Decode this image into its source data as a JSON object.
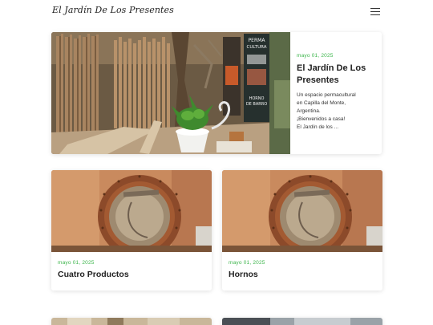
{
  "header": {
    "logo_text": "El Jardín De Los Presentes",
    "menu_icon": "hamburger-menu-icon"
  },
  "posts": {
    "featured": {
      "date": "mayo 01, 2025",
      "title_line1": "El Jardín De Los",
      "title_line2": "Presentes",
      "excerpt_line1": "Un espacio permacultural",
      "excerpt_line2": "en Capilla del Monte,",
      "excerpt_line3": "Argentina.",
      "excerpt_line4": "¡Bienvenidos a casa!",
      "excerpt_line5": "El Jardín de los ...",
      "sign_line1": "PERMA",
      "sign_line2": "CULTURA",
      "sign_line3": "HORNO",
      "sign_line4": "DE BARRO"
    },
    "cards": [
      {
        "date": "mayo 01, 2025",
        "title": "Cuatro Productos"
      },
      {
        "date": "mayo 01, 2025",
        "title": "Hornos"
      }
    ]
  },
  "colors": {
    "date_accent": "#3bb54a",
    "text": "#222222",
    "background": "#ffffff"
  }
}
